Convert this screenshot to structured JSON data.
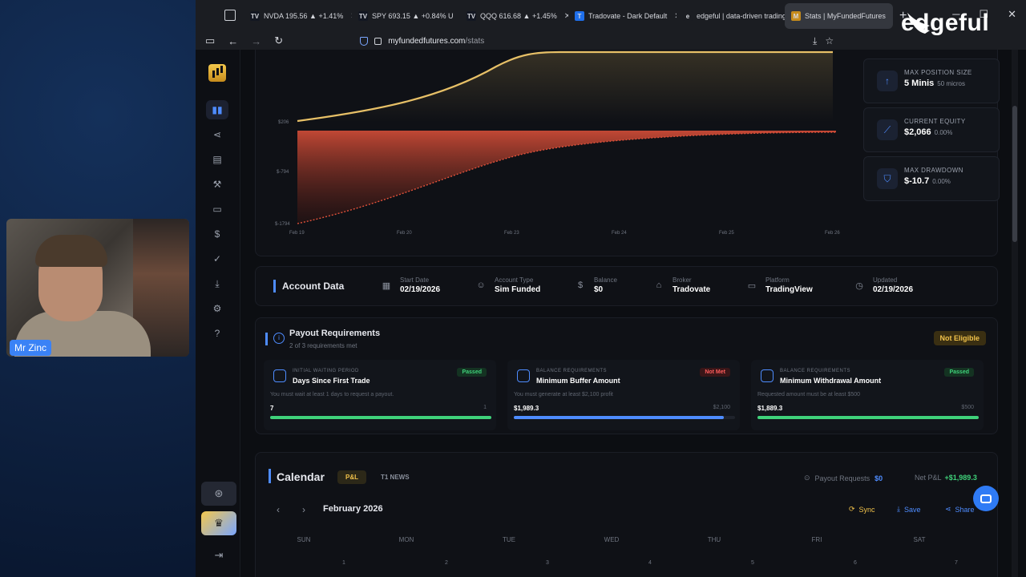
{
  "webcam": {
    "name": "Mr Zinc"
  },
  "watermark": "edgeful",
  "browser": {
    "tabs": [
      {
        "label": "NVDA 195.56 ▲ +1.41%",
        "fav": "TV",
        "fav_color": "#131722"
      },
      {
        "label": "SPY 693.15 ▲ +0.84% U",
        "fav": "TV",
        "fav_color": "#131722"
      },
      {
        "label": "QQQ 616.68 ▲ +1.45%",
        "fav": "TV",
        "fav_color": "#131722"
      },
      {
        "label": "Tradovate - Dark Default",
        "fav": "T",
        "fav_color": "#1f6feb"
      },
      {
        "label": "edgeful | data-driven trading",
        "fav": "e",
        "fav_color": "#1b1d22"
      },
      {
        "label": "Stats | MyFundedFutures",
        "fav": "M",
        "fav_color": "#c58b1c"
      }
    ],
    "url_host": "myfundedfutures.com",
    "url_path": "/stats"
  },
  "chart": {
    "y_ticks": [
      "$206",
      "$-794",
      "$-1794"
    ],
    "x_ticks": [
      "Feb 19",
      "Feb 20",
      "Feb 23",
      "Feb 24",
      "Feb 25",
      "Feb 26"
    ],
    "equity_color": "#e7c067",
    "drawdown_color": "#e0513a"
  },
  "stats": [
    {
      "label": "MAX POSITION SIZE",
      "value": "5 Minis",
      "sub": "50 micros",
      "icon": "arrow-up-icon"
    },
    {
      "label": "CURRENT EQUITY",
      "value": "$2,066",
      "sub": "0.00%",
      "icon": "trend-chart-icon"
    },
    {
      "label": "MAX DRAWDOWN",
      "value": "$-10.7",
      "sub": "0.00%",
      "icon": "shield-icon"
    }
  ],
  "account": {
    "title": "Account Data",
    "items": [
      {
        "label": "Start Date",
        "value": "02/19/2026",
        "icon": "calendar-icon"
      },
      {
        "label": "Account Type",
        "value": "Sim Funded",
        "icon": "user-icon"
      },
      {
        "label": "Balance",
        "value": "$0",
        "icon": "dollar-icon"
      },
      {
        "label": "Broker",
        "value": "Tradovate",
        "icon": "bank-icon"
      },
      {
        "label": "Platform",
        "value": "TradingView",
        "icon": "monitor-icon"
      },
      {
        "label": "Updated",
        "value": "02/19/2026",
        "icon": "clock-icon"
      }
    ]
  },
  "payout": {
    "title": "Payout Requirements",
    "subtitle": "2 of 3 requirements met",
    "status": "Not Eligible",
    "requirements": [
      {
        "category": "INITIAL WAITING PERIOD",
        "title": "Days Since First Trade",
        "badge": "Passed",
        "desc": "You must wait at least 1 days to request a payout.",
        "value": "7",
        "goal": "1",
        "progress": 1.0,
        "bar_color": "#3fd27a"
      },
      {
        "category": "BALANCE REQUIREMENTS",
        "title": "Minimum Buffer Amount",
        "badge": "Not Met",
        "desc": "You must generate at least $2,100 profit",
        "value": "$1,989.3",
        "goal": "$2,100",
        "progress": 0.95,
        "bar_color": "#4e8cff"
      },
      {
        "category": "BALANCE REQUIREMENTS",
        "title": "Minimum Withdrawal Amount",
        "badge": "Passed",
        "desc": "Requested amount must be at least $500",
        "value": "$1,889.3",
        "goal": "$500",
        "progress": 1.0,
        "bar_color": "#3fd27a"
      }
    ]
  },
  "calendar": {
    "title": "Calendar",
    "tabs": [
      "P&L",
      "T1 NEWS"
    ],
    "payout_requests_label": "Payout Requests",
    "payout_requests_value": "$0",
    "net_pnl_label": "Net P&L",
    "net_pnl_value": "+$1,989.3",
    "month": "February 2026",
    "actions": [
      "Sync",
      "Save",
      "Share"
    ],
    "weekdays": [
      "SUN",
      "MON",
      "TUE",
      "WED",
      "THU",
      "FRI",
      "SAT"
    ],
    "first_row": [
      "",
      "1",
      "2",
      "3",
      "4",
      "5",
      "6",
      "7"
    ]
  }
}
